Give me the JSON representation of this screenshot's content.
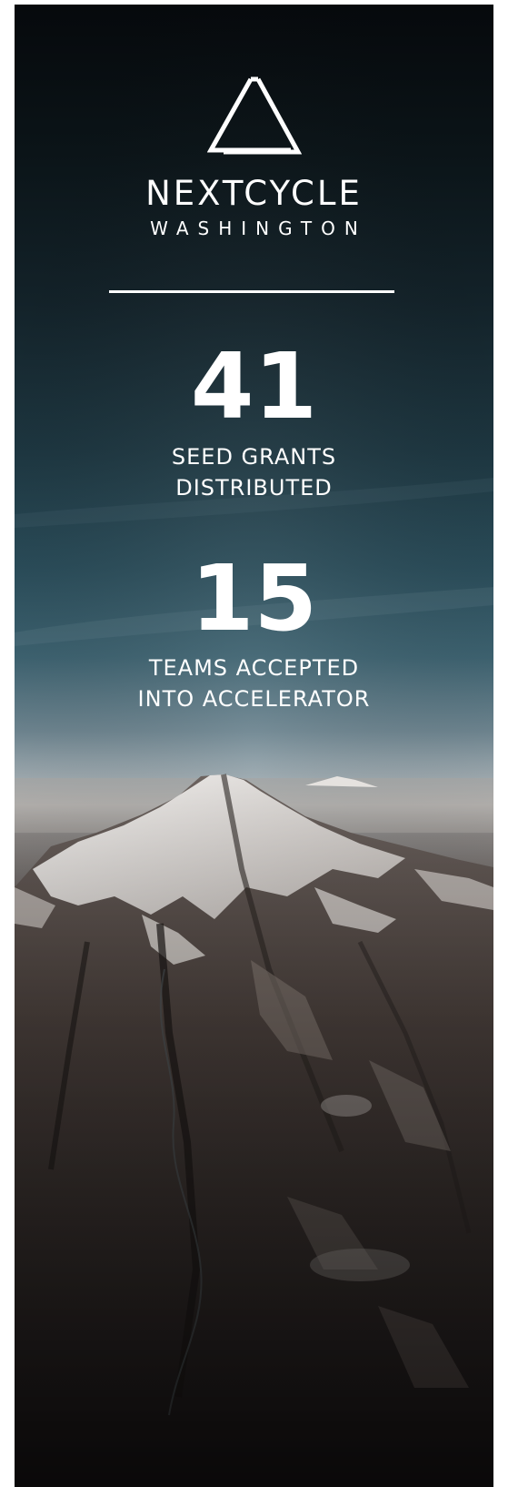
{
  "brand": {
    "name": "NEXTCYCLE",
    "subtitle": "WASHINGTON"
  },
  "stats": [
    {
      "number": "41",
      "label_line1": "SEED GRANTS",
      "label_line2": "DISTRIBUTED"
    },
    {
      "number": "15",
      "label_line1": "TEAMS ACCEPTED",
      "label_line2": "INTO ACCELERATOR"
    }
  ],
  "background": {
    "image_subject": "aerial view of snow-capped mountain range under a dark blue sky",
    "colors": {
      "sky_top": "#06090c",
      "sky_mid": "#2a4c59",
      "horizon": "#c8c6c4",
      "rock": "#3b3431",
      "snow": "#e8e6e4"
    }
  }
}
